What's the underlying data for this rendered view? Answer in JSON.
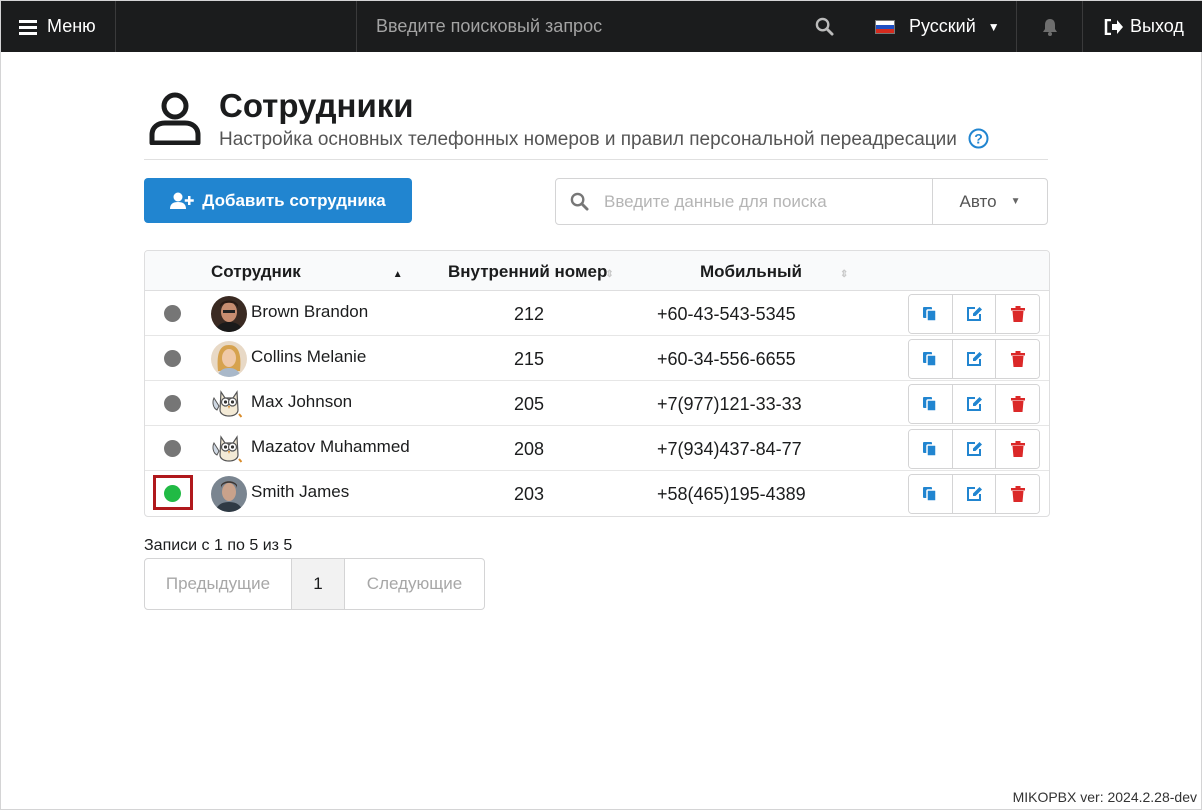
{
  "topbar": {
    "menu_label": "Меню",
    "search_placeholder": "Введите поисковый запрос",
    "language": "Русский",
    "logout_label": "Выход"
  },
  "header": {
    "title": "Сотрудники",
    "subtitle": "Настройка основных телефонных номеров и правил персональной переадресации"
  },
  "toolbar": {
    "add_label": "Добавить сотрудника",
    "search_placeholder": "Введите данные для поиска",
    "page_size": "Авто"
  },
  "table": {
    "columns": {
      "employee": "Сотрудник",
      "extension": "Внутренний номер",
      "mobile": "Мобильный"
    },
    "rows": [
      {
        "name": "Brown Brandon",
        "extension": "212",
        "mobile": "+60-43-543-5345",
        "status": "offline",
        "avatar": "photo-man-dark"
      },
      {
        "name": "Collins Melanie",
        "extension": "215",
        "mobile": "+60-34-556-6655",
        "status": "offline",
        "avatar": "photo-woman-blonde"
      },
      {
        "name": "Max Johnson",
        "extension": "205",
        "mobile": "+7(977)121-33-33",
        "status": "offline",
        "avatar": "owl-cartoon"
      },
      {
        "name": "Mazatov Muhammed",
        "extension": "208",
        "mobile": "+7(934)437-84-77",
        "status": "offline",
        "avatar": "owl-cartoon"
      },
      {
        "name": "Smith James",
        "extension": "203",
        "mobile": "+58(465)195-4389",
        "status": "online",
        "avatar": "photo-man-grey"
      }
    ]
  },
  "pagination": {
    "info": "Записи с 1 по 5 из 5",
    "prev": "Предыдущие",
    "current": "1",
    "next": "Следующие"
  },
  "footer": {
    "version": "MIKOPBX ver: 2024.2.28-dev"
  },
  "colors": {
    "topbar": "#1b1c1d",
    "primary": "#2185d0",
    "online": "#21ba45",
    "offline": "#767676",
    "delete": "#db2828",
    "highlight": "#b0181c"
  }
}
